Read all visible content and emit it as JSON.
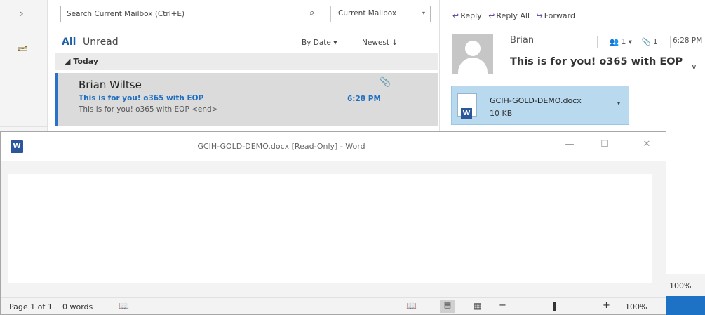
{
  "outlook": {
    "nav": {
      "expand_icon": "chevron-right-icon",
      "folder_icon": "folder-icon"
    },
    "search": {
      "placeholder": "Search Current Mailbox (Ctrl+E)",
      "scope": "Current Mailbox"
    },
    "filters": {
      "all": "All",
      "unread": "Unread",
      "sort_by": "By Date",
      "order": "Newest"
    },
    "group_header": "Today",
    "message": {
      "sender": "Brian Wiltse",
      "subject": "This is for you! o365 with EOP",
      "preview": "This is for you! o365 with EOP <end>",
      "time": "6:28 PM"
    },
    "reading": {
      "actions": {
        "reply": "Reply",
        "reply_all": "Reply All",
        "forward": "Forward"
      },
      "from": "Brian",
      "people_count": "1",
      "attachment_count": "1",
      "time": "6:28 PM",
      "subject": "This is for you! o365 with EOP",
      "attachment": {
        "name": "GCIH-GOLD-DEMO.docx",
        "size": "10 KB"
      }
    },
    "zoom_edge": "100%"
  },
  "word": {
    "title": "GCIH-GOLD-DEMO.docx [Read-Only] - Word",
    "status": {
      "pages": "Page 1 of 1",
      "words": "0 words",
      "zoom": "100%",
      "zoom_level_percent": 100
    }
  },
  "colors": {
    "accent_blue": "#1f6fc1",
    "word_blue": "#2b579a",
    "attachment_bg": "#b9d9ef",
    "selected_row": "#dbdbdb"
  }
}
